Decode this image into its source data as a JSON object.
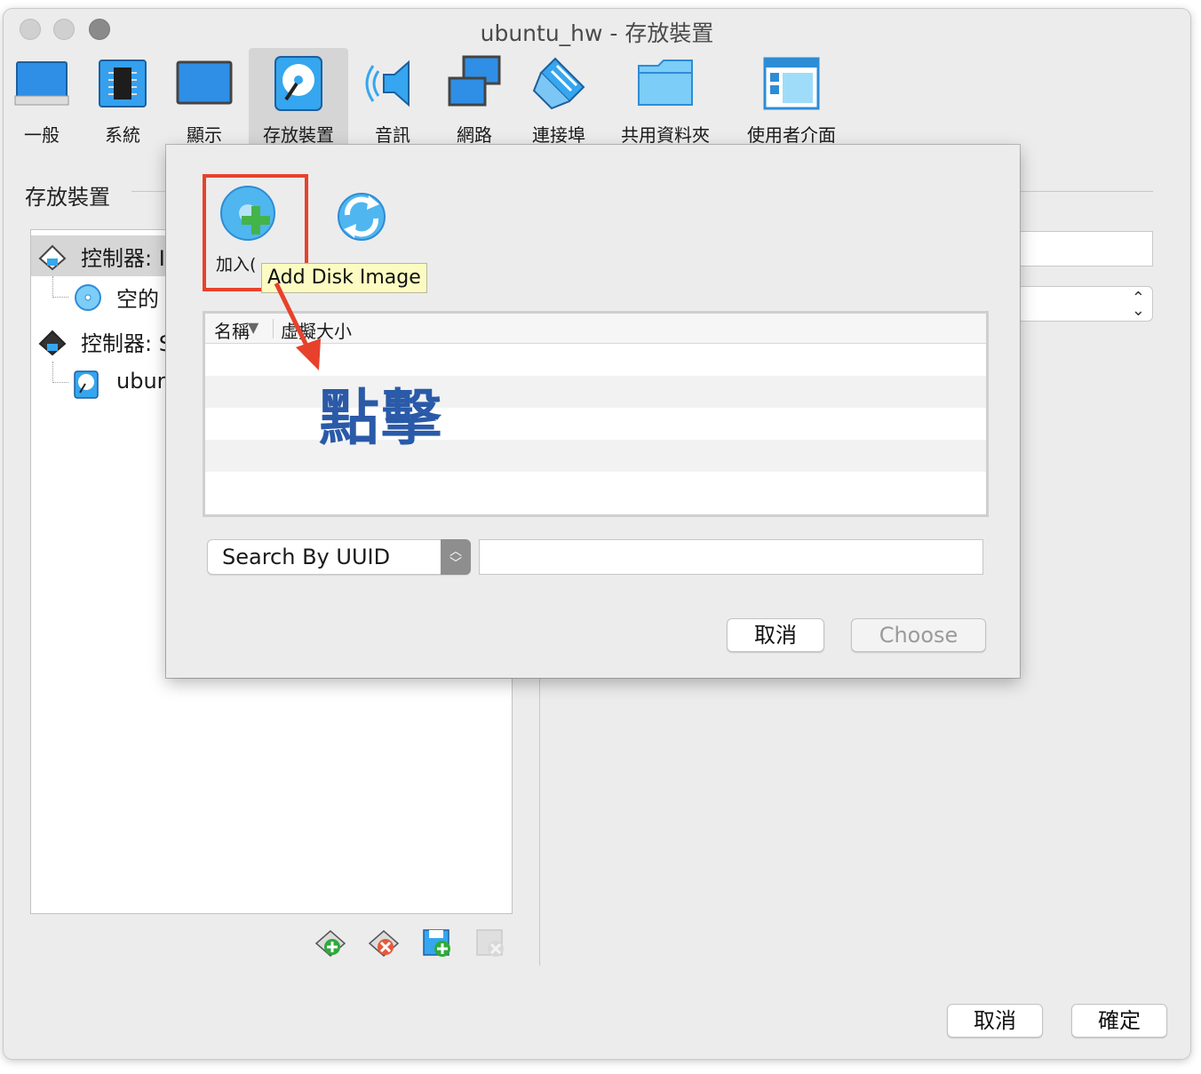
{
  "window": {
    "title": "ubuntu_hw - 存放裝置"
  },
  "toolbar": {
    "items": [
      {
        "label": "一般",
        "icon": "general-icon"
      },
      {
        "label": "系統",
        "icon": "system-chip-icon"
      },
      {
        "label": "顯示",
        "icon": "display-monitor-icon"
      },
      {
        "label": "存放裝置",
        "icon": "storage-disk-icon"
      },
      {
        "label": "音訊",
        "icon": "audio-speaker-icon"
      },
      {
        "label": "網路",
        "icon": "network-icon"
      },
      {
        "label": "連接埠",
        "icon": "ports-icon"
      },
      {
        "label": "共用資料夾",
        "icon": "shared-folder-icon"
      },
      {
        "label": "使用者介面",
        "icon": "user-interface-icon"
      }
    ],
    "active": "存放裝置"
  },
  "section": {
    "title": "存放裝置"
  },
  "tree": {
    "items": [
      {
        "label": "控制器: I",
        "icon": "controller-icon"
      },
      {
        "label": "空的",
        "icon": "optical-disc-icon"
      },
      {
        "label": "控制器: S",
        "icon": "controller-icon"
      },
      {
        "label": "ubun",
        "icon": "hard-disk-icon"
      }
    ]
  },
  "dialog": {
    "add_label": "加入(",
    "tooltip": "Add Disk Image",
    "columns": {
      "name": "名稱",
      "size": "虛擬大小"
    },
    "annotation": "點擊",
    "search_mode": "Search By UUID",
    "cancel_label": "取消",
    "choose_label": "Choose"
  },
  "footer": {
    "cancel_label": "取消",
    "ok_label": "確定"
  },
  "colors": {
    "highlight": "#e8412b",
    "annotation": "#2a5aa8",
    "tooltip_bg": "#fcfcc2"
  }
}
